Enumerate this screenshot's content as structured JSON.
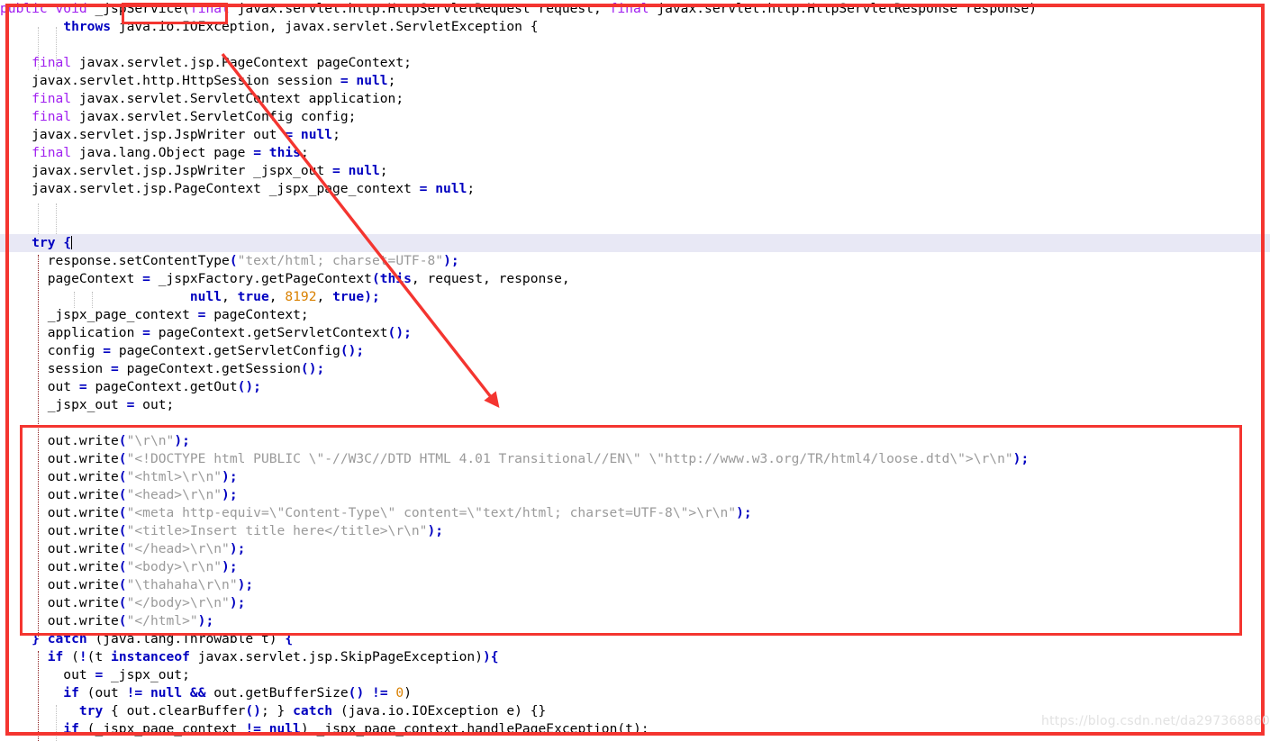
{
  "editor": {
    "language": "java",
    "colors": {
      "keyword": "#0000c0",
      "modifier": "#a020f0",
      "string": "#9a9a9a",
      "number": "#d98000",
      "text": "#000000",
      "background": "#ffffff",
      "current_line_highlight": "#e8e8f5",
      "annotation_red": "#f43530",
      "indent_guide": "#c0c0c0",
      "indent_guide_active": "#8b2020"
    },
    "lines": [
      {
        "id": "l1",
        "indent": 0,
        "tokens": [
          {
            "t": "public",
            "c": "mod"
          },
          {
            "t": " ",
            "c": "plain"
          },
          {
            "t": "void",
            "c": "mod"
          },
          {
            "t": " _jspService(",
            "c": "plain"
          },
          {
            "t": "final",
            "c": "mod"
          },
          {
            "t": " javax.servlet.http.HttpServletRequest request, ",
            "c": "plain"
          },
          {
            "t": "final",
            "c": "mod"
          },
          {
            "t": " javax.servlet.http.HttpServletResponse response)",
            "c": "plain"
          }
        ]
      },
      {
        "id": "l2",
        "indent": 0,
        "tokens": [
          {
            "t": "        ",
            "c": "plain"
          },
          {
            "t": "throws",
            "c": "kw"
          },
          {
            "t": " java.io.IOException, javax.servlet.ServletException ",
            "c": "plain"
          },
          {
            "t": "{",
            "c": "plain"
          }
        ]
      },
      {
        "id": "l3",
        "indent": 0,
        "tokens": [
          {
            "t": "",
            "c": "plain"
          }
        ]
      },
      {
        "id": "l4",
        "indent": 0,
        "tokens": [
          {
            "t": "    ",
            "c": "plain"
          },
          {
            "t": "final",
            "c": "mod"
          },
          {
            "t": " javax.servlet.jsp.PageContext pageContext;",
            "c": "plain"
          }
        ]
      },
      {
        "id": "l5",
        "indent": 0,
        "tokens": [
          {
            "t": "    javax.servlet.http.HttpSession session ",
            "c": "plain"
          },
          {
            "t": "=",
            "c": "kw"
          },
          {
            "t": " ",
            "c": "plain"
          },
          {
            "t": "null",
            "c": "kw"
          },
          {
            "t": ";",
            "c": "plain"
          }
        ]
      },
      {
        "id": "l6",
        "indent": 0,
        "tokens": [
          {
            "t": "    ",
            "c": "plain"
          },
          {
            "t": "final",
            "c": "mod"
          },
          {
            "t": " javax.servlet.ServletContext application;",
            "c": "plain"
          }
        ]
      },
      {
        "id": "l7",
        "indent": 0,
        "tokens": [
          {
            "t": "    ",
            "c": "plain"
          },
          {
            "t": "final",
            "c": "mod"
          },
          {
            "t": " javax.servlet.ServletConfig config;",
            "c": "plain"
          }
        ]
      },
      {
        "id": "l8",
        "indent": 0,
        "tokens": [
          {
            "t": "    javax.servlet.jsp.JspWriter out ",
            "c": "plain"
          },
          {
            "t": "=",
            "c": "kw"
          },
          {
            "t": " ",
            "c": "plain"
          },
          {
            "t": "null",
            "c": "kw"
          },
          {
            "t": ";",
            "c": "plain"
          }
        ]
      },
      {
        "id": "l9",
        "indent": 0,
        "tokens": [
          {
            "t": "    ",
            "c": "plain"
          },
          {
            "t": "final",
            "c": "mod"
          },
          {
            "t": " java.lang.Object page ",
            "c": "plain"
          },
          {
            "t": "=",
            "c": "kw"
          },
          {
            "t": " ",
            "c": "plain"
          },
          {
            "t": "this",
            "c": "kw"
          },
          {
            "t": ";",
            "c": "plain"
          }
        ]
      },
      {
        "id": "l10",
        "indent": 0,
        "tokens": [
          {
            "t": "    javax.servlet.jsp.JspWriter _jspx_out ",
            "c": "plain"
          },
          {
            "t": "=",
            "c": "kw"
          },
          {
            "t": " ",
            "c": "plain"
          },
          {
            "t": "null",
            "c": "kw"
          },
          {
            "t": ";",
            "c": "plain"
          }
        ]
      },
      {
        "id": "l11",
        "indent": 0,
        "tokens": [
          {
            "t": "    javax.servlet.jsp.PageContext _jspx_page_context ",
            "c": "plain"
          },
          {
            "t": "=",
            "c": "kw"
          },
          {
            "t": " ",
            "c": "plain"
          },
          {
            "t": "null",
            "c": "kw"
          },
          {
            "t": ";",
            "c": "plain"
          }
        ]
      },
      {
        "id": "l12",
        "indent": 0,
        "tokens": [
          {
            "t": "",
            "c": "plain"
          }
        ]
      },
      {
        "id": "l13",
        "indent": 0,
        "tokens": [
          {
            "t": "",
            "c": "plain"
          }
        ]
      },
      {
        "id": "l14",
        "indent": 0,
        "highlight": true,
        "caret": true,
        "tokens": [
          {
            "t": "    ",
            "c": "plain"
          },
          {
            "t": "try",
            "c": "kw"
          },
          {
            "t": " ",
            "c": "plain"
          },
          {
            "t": "{",
            "c": "punct"
          }
        ]
      },
      {
        "id": "l15",
        "indent": 0,
        "tokens": [
          {
            "t": "      response.setContentType",
            "c": "plain"
          },
          {
            "t": "(",
            "c": "punct"
          },
          {
            "t": "\"text/html; charset=UTF-8\"",
            "c": "str"
          },
          {
            "t": ");",
            "c": "punct"
          }
        ]
      },
      {
        "id": "l16",
        "indent": 0,
        "tokens": [
          {
            "t": "      pageContext ",
            "c": "plain"
          },
          {
            "t": "=",
            "c": "kw"
          },
          {
            "t": " _jspxFactory.getPageContext",
            "c": "plain"
          },
          {
            "t": "(",
            "c": "punct"
          },
          {
            "t": "this",
            "c": "kw"
          },
          {
            "t": ", request, response,",
            "c": "plain"
          }
        ]
      },
      {
        "id": "l17",
        "indent": 0,
        "tokens": [
          {
            "t": "      \t\t\t",
            "c": "plain"
          },
          {
            "t": "null",
            "c": "kw"
          },
          {
            "t": ", ",
            "c": "plain"
          },
          {
            "t": "true",
            "c": "kw"
          },
          {
            "t": ", ",
            "c": "plain"
          },
          {
            "t": "8192",
            "c": "num"
          },
          {
            "t": ", ",
            "c": "plain"
          },
          {
            "t": "true",
            "c": "kw"
          },
          {
            "t": ");",
            "c": "punct"
          }
        ]
      },
      {
        "id": "l18",
        "indent": 0,
        "tokens": [
          {
            "t": "      _jspx_page_context ",
            "c": "plain"
          },
          {
            "t": "=",
            "c": "kw"
          },
          {
            "t": " pageContext;",
            "c": "plain"
          }
        ]
      },
      {
        "id": "l19",
        "indent": 0,
        "tokens": [
          {
            "t": "      application ",
            "c": "plain"
          },
          {
            "t": "=",
            "c": "kw"
          },
          {
            "t": " pageContext.getServletContext",
            "c": "plain"
          },
          {
            "t": "();",
            "c": "punct"
          }
        ]
      },
      {
        "id": "l20",
        "indent": 0,
        "tokens": [
          {
            "t": "      config ",
            "c": "plain"
          },
          {
            "t": "=",
            "c": "kw"
          },
          {
            "t": " pageContext.getServletConfig",
            "c": "plain"
          },
          {
            "t": "();",
            "c": "punct"
          }
        ]
      },
      {
        "id": "l21",
        "indent": 0,
        "tokens": [
          {
            "t": "      session ",
            "c": "plain"
          },
          {
            "t": "=",
            "c": "kw"
          },
          {
            "t": " pageContext.getSession",
            "c": "plain"
          },
          {
            "t": "();",
            "c": "punct"
          }
        ]
      },
      {
        "id": "l22",
        "indent": 0,
        "tokens": [
          {
            "t": "      out ",
            "c": "plain"
          },
          {
            "t": "=",
            "c": "kw"
          },
          {
            "t": " pageContext.getOut",
            "c": "plain"
          },
          {
            "t": "();",
            "c": "punct"
          }
        ]
      },
      {
        "id": "l23",
        "indent": 0,
        "tokens": [
          {
            "t": "      _jspx_out ",
            "c": "plain"
          },
          {
            "t": "=",
            "c": "kw"
          },
          {
            "t": " out;",
            "c": "plain"
          }
        ]
      },
      {
        "id": "l24",
        "indent": 0,
        "tokens": [
          {
            "t": "",
            "c": "plain"
          }
        ]
      },
      {
        "id": "l25",
        "indent": 0,
        "tokens": [
          {
            "t": "      out.write",
            "c": "plain"
          },
          {
            "t": "(",
            "c": "punct"
          },
          {
            "t": "\"\\r\\n\"",
            "c": "str"
          },
          {
            "t": ");",
            "c": "punct"
          }
        ]
      },
      {
        "id": "l26",
        "indent": 0,
        "tokens": [
          {
            "t": "      out.write",
            "c": "plain"
          },
          {
            "t": "(",
            "c": "punct"
          },
          {
            "t": "\"<!DOCTYPE html PUBLIC \\\"-//W3C//DTD HTML 4.01 Transitional//EN\\\" \\\"http://www.w3.org/TR/html4/loose.dtd\\\">\\r\\n\"",
            "c": "str"
          },
          {
            "t": ");",
            "c": "punct"
          }
        ]
      },
      {
        "id": "l27",
        "indent": 0,
        "tokens": [
          {
            "t": "      out.write",
            "c": "plain"
          },
          {
            "t": "(",
            "c": "punct"
          },
          {
            "t": "\"<html>\\r\\n\"",
            "c": "str"
          },
          {
            "t": ");",
            "c": "punct"
          }
        ]
      },
      {
        "id": "l28",
        "indent": 0,
        "tokens": [
          {
            "t": "      out.write",
            "c": "plain"
          },
          {
            "t": "(",
            "c": "punct"
          },
          {
            "t": "\"<head>\\r\\n\"",
            "c": "str"
          },
          {
            "t": ");",
            "c": "punct"
          }
        ]
      },
      {
        "id": "l29",
        "indent": 0,
        "tokens": [
          {
            "t": "      out.write",
            "c": "plain"
          },
          {
            "t": "(",
            "c": "punct"
          },
          {
            "t": "\"<meta http-equiv=\\\"Content-Type\\\" content=\\\"text/html; charset=UTF-8\\\">\\r\\n\"",
            "c": "str"
          },
          {
            "t": ");",
            "c": "punct"
          }
        ]
      },
      {
        "id": "l30",
        "indent": 0,
        "tokens": [
          {
            "t": "      out.write",
            "c": "plain"
          },
          {
            "t": "(",
            "c": "punct"
          },
          {
            "t": "\"<title>Insert title here</title>\\r\\n\"",
            "c": "str"
          },
          {
            "t": ");",
            "c": "punct"
          }
        ]
      },
      {
        "id": "l31",
        "indent": 0,
        "tokens": [
          {
            "t": "      out.write",
            "c": "plain"
          },
          {
            "t": "(",
            "c": "punct"
          },
          {
            "t": "\"</head>\\r\\n\"",
            "c": "str"
          },
          {
            "t": ");",
            "c": "punct"
          }
        ]
      },
      {
        "id": "l32",
        "indent": 0,
        "tokens": [
          {
            "t": "      out.write",
            "c": "plain"
          },
          {
            "t": "(",
            "c": "punct"
          },
          {
            "t": "\"<body>\\r\\n\"",
            "c": "str"
          },
          {
            "t": ");",
            "c": "punct"
          }
        ]
      },
      {
        "id": "l33",
        "indent": 0,
        "tokens": [
          {
            "t": "      out.write",
            "c": "plain"
          },
          {
            "t": "(",
            "c": "punct"
          },
          {
            "t": "\"\\thahaha\\r\\n\"",
            "c": "str"
          },
          {
            "t": ");",
            "c": "punct"
          }
        ]
      },
      {
        "id": "l34",
        "indent": 0,
        "tokens": [
          {
            "t": "      out.write",
            "c": "plain"
          },
          {
            "t": "(",
            "c": "punct"
          },
          {
            "t": "\"</body>\\r\\n\"",
            "c": "str"
          },
          {
            "t": ");",
            "c": "punct"
          }
        ]
      },
      {
        "id": "l35",
        "indent": 0,
        "tokens": [
          {
            "t": "      out.write",
            "c": "plain"
          },
          {
            "t": "(",
            "c": "punct"
          },
          {
            "t": "\"</html>\"",
            "c": "str"
          },
          {
            "t": ");",
            "c": "punct"
          }
        ]
      },
      {
        "id": "l36",
        "indent": 0,
        "tokens": [
          {
            "t": "    ",
            "c": "plain"
          },
          {
            "t": "}",
            "c": "punct"
          },
          {
            "t": " ",
            "c": "plain"
          },
          {
            "t": "catch",
            "c": "kw"
          },
          {
            "t": " (java.lang.Throwable t) ",
            "c": "plain"
          },
          {
            "t": "{",
            "c": "punct"
          }
        ]
      },
      {
        "id": "l37",
        "indent": 0,
        "tokens": [
          {
            "t": "      ",
            "c": "plain"
          },
          {
            "t": "if",
            "c": "kw"
          },
          {
            "t": " (",
            "c": "plain"
          },
          {
            "t": "!",
            "c": "kw"
          },
          {
            "t": "(t ",
            "c": "plain"
          },
          {
            "t": "instanceof",
            "c": "kw"
          },
          {
            "t": " javax.servlet.jsp.SkipPageException)",
            "c": "plain"
          },
          {
            "t": "){",
            "c": "punct"
          }
        ]
      },
      {
        "id": "l38",
        "indent": 0,
        "tokens": [
          {
            "t": "        out ",
            "c": "plain"
          },
          {
            "t": "=",
            "c": "kw"
          },
          {
            "t": " _jspx_out;",
            "c": "plain"
          }
        ]
      },
      {
        "id": "l39",
        "indent": 0,
        "tokens": [
          {
            "t": "        ",
            "c": "plain"
          },
          {
            "t": "if",
            "c": "kw"
          },
          {
            "t": " (out ",
            "c": "plain"
          },
          {
            "t": "!=",
            "c": "kw"
          },
          {
            "t": " ",
            "c": "plain"
          },
          {
            "t": "null",
            "c": "kw"
          },
          {
            "t": " ",
            "c": "plain"
          },
          {
            "t": "&&",
            "c": "kw"
          },
          {
            "t": " out.getBufferSize",
            "c": "plain"
          },
          {
            "t": "()",
            "c": "punct"
          },
          {
            "t": " ",
            "c": "plain"
          },
          {
            "t": "!=",
            "c": "kw"
          },
          {
            "t": " ",
            "c": "plain"
          },
          {
            "t": "0",
            "c": "num"
          },
          {
            "t": ")",
            "c": "plain"
          }
        ]
      },
      {
        "id": "l40",
        "indent": 0,
        "tokens": [
          {
            "t": "          ",
            "c": "plain"
          },
          {
            "t": "try",
            "c": "kw"
          },
          {
            "t": " { out.clearBuffer",
            "c": "plain"
          },
          {
            "t": "()",
            "c": "punct"
          },
          {
            "t": "; } ",
            "c": "plain"
          },
          {
            "t": "catch",
            "c": "kw"
          },
          {
            "t": " (java.io.IOException e) {}",
            "c": "plain"
          }
        ]
      },
      {
        "id": "l41",
        "indent": 0,
        "tokens": [
          {
            "t": "        ",
            "c": "plain"
          },
          {
            "t": "if",
            "c": "kw"
          },
          {
            "t": " (_jspx_page_context ",
            "c": "plain"
          },
          {
            "t": "!=",
            "c": "kw"
          },
          {
            "t": " ",
            "c": "plain"
          },
          {
            "t": "null",
            "c": "kw"
          },
          {
            "t": ") _jspx_page_context.handlePageException(t);",
            "c": "plain"
          }
        ]
      }
    ]
  },
  "annotations": {
    "method_name_box": {
      "label": "_jspService",
      "note": "red rectangle highlighting the _jspService method name"
    },
    "outwrite_block_box": {
      "label": "out.write block",
      "note": "red rectangle around the generated out.write(...) statements"
    },
    "outer_box": {
      "label": "full code region",
      "note": "red rectangle enclosing the whole code listing"
    },
    "arrow": {
      "label": "arrow from _jspService to out.write block"
    }
  },
  "watermark": {
    "text": "https://blog.csdn.net/da297368860"
  }
}
